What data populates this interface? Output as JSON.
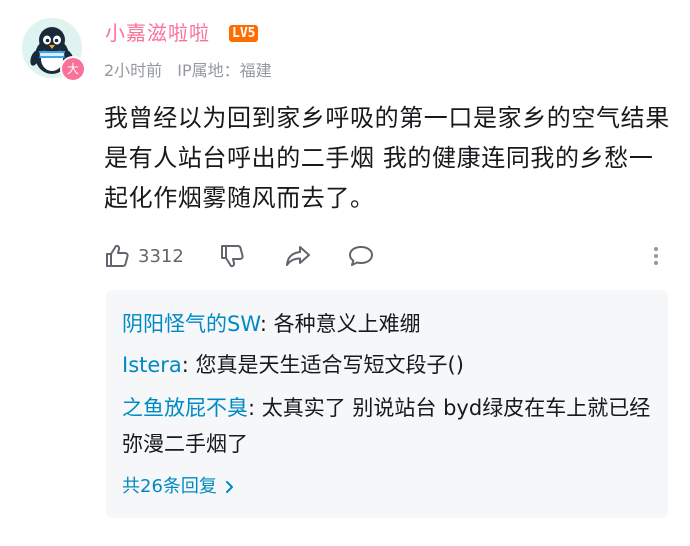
{
  "comment": {
    "user": {
      "name": "小嘉滋啦啦",
      "level_badge": "LV5",
      "avatar_badge": "大"
    },
    "meta": {
      "time": "2小时前",
      "ip_location": "IP属地：福建"
    },
    "text": "我曾经以为回到家乡呼吸的第一口是家乡的空气结果是有人站台呼出的二手烟 我的健康连同我的乡愁一起化作烟雾随风而去了。",
    "actions": {
      "like_count": "3312",
      "like_icon": "thumbs-up-icon",
      "dislike_icon": "thumbs-down-icon",
      "share_icon": "share-icon",
      "reply_icon": "chat-bubble-icon",
      "more_icon": "more-vertical-icon"
    },
    "replies": [
      {
        "author": "阴阳怪气的SW",
        "text": ": 各种意义上难绷"
      },
      {
        "author": "Istera",
        "text": ": 您真是天生适合写短文段子()"
      },
      {
        "author": "之鱼放屁不臭",
        "text": ": 太真实了 别说站台 byd绿皮在车上就已经弥漫二手烟了"
      }
    ],
    "replies_more": "共26条回复"
  }
}
